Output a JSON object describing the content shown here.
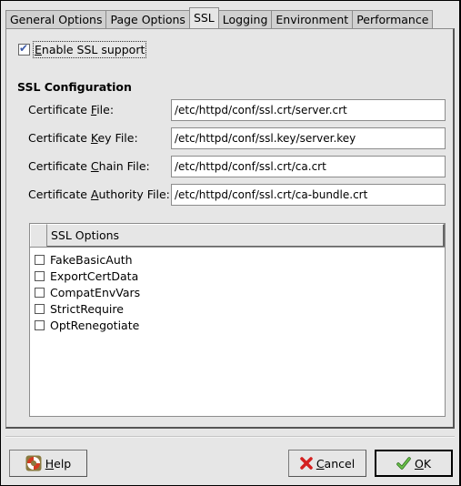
{
  "tabs": [
    {
      "label": "General Options",
      "active": false
    },
    {
      "label": "Page Options",
      "active": false
    },
    {
      "label": "SSL",
      "active": true
    },
    {
      "label": "Logging",
      "active": false
    },
    {
      "label": "Environment",
      "active": false
    },
    {
      "label": "Performance",
      "active": false
    }
  ],
  "ssl": {
    "enable_label_mnemonic": "E",
    "enable_label_rest": "nable SSL support",
    "enable_checked": true,
    "section_title": "SSL Configuration",
    "fields": [
      {
        "label_pre": "Certificate ",
        "mnemonic": "F",
        "label_post": "ile:",
        "value": "/etc/httpd/conf/ssl.crt/server.crt"
      },
      {
        "label_pre": "Certificate ",
        "mnemonic": "K",
        "label_post": "ey File:",
        "value": "/etc/httpd/conf/ssl.key/server.key"
      },
      {
        "label_pre": "Certificate ",
        "mnemonic": "C",
        "label_post": "hain File:",
        "value": "/etc/httpd/conf/ssl.crt/ca.crt"
      },
      {
        "label_pre": "Certificate ",
        "mnemonic": "A",
        "label_post": "uthority File:",
        "value": "/etc/httpd/conf/ssl.crt/ca-bundle.crt"
      }
    ],
    "options_header": "SSL Options",
    "options": [
      {
        "label": "FakeBasicAuth",
        "checked": false
      },
      {
        "label": "ExportCertData",
        "checked": false
      },
      {
        "label": "CompatEnvVars",
        "checked": false
      },
      {
        "label": "StrictRequire",
        "checked": false
      },
      {
        "label": "OptRenegotiate",
        "checked": false
      }
    ]
  },
  "buttons": {
    "help": {
      "mnemonic": "H",
      "rest": "elp",
      "icon": "lifebuoy-icon"
    },
    "cancel": {
      "mnemonic": "C",
      "rest": "ancel",
      "icon": "red-x-icon"
    },
    "ok": {
      "mnemonic": "O",
      "rest": "K",
      "icon": "green-check-icon"
    }
  },
  "colors": {
    "background": "#e6e6e6",
    "check_blue": "#3c5aa8",
    "cancel_red": "#d42020",
    "ok_green": "#4aa02c",
    "help_red": "#d43a20"
  }
}
